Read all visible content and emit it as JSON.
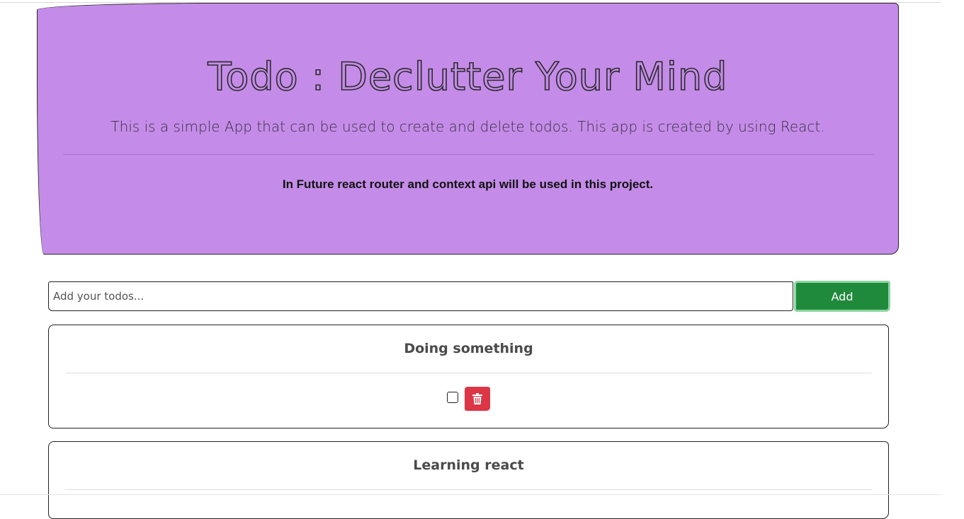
{
  "hero": {
    "title": "Todo : Declutter Your Mind",
    "subtitle": "This is a simple App that can be used to create and delete todos. This app is created by using React.",
    "note": "In Future react router and context api will be used in this project."
  },
  "form": {
    "placeholder": "Add your todos...",
    "value": "",
    "add_label": "Add"
  },
  "todos": [
    {
      "title": "Doing something",
      "completed": false,
      "delete_icon": "trash-icon"
    },
    {
      "title": "Learning react",
      "completed": false,
      "delete_icon": "trash-icon"
    }
  ],
  "colors": {
    "hero_bg": "#c48ce8",
    "add_button": "#1f8a3b",
    "delete_button": "#dc3545"
  }
}
